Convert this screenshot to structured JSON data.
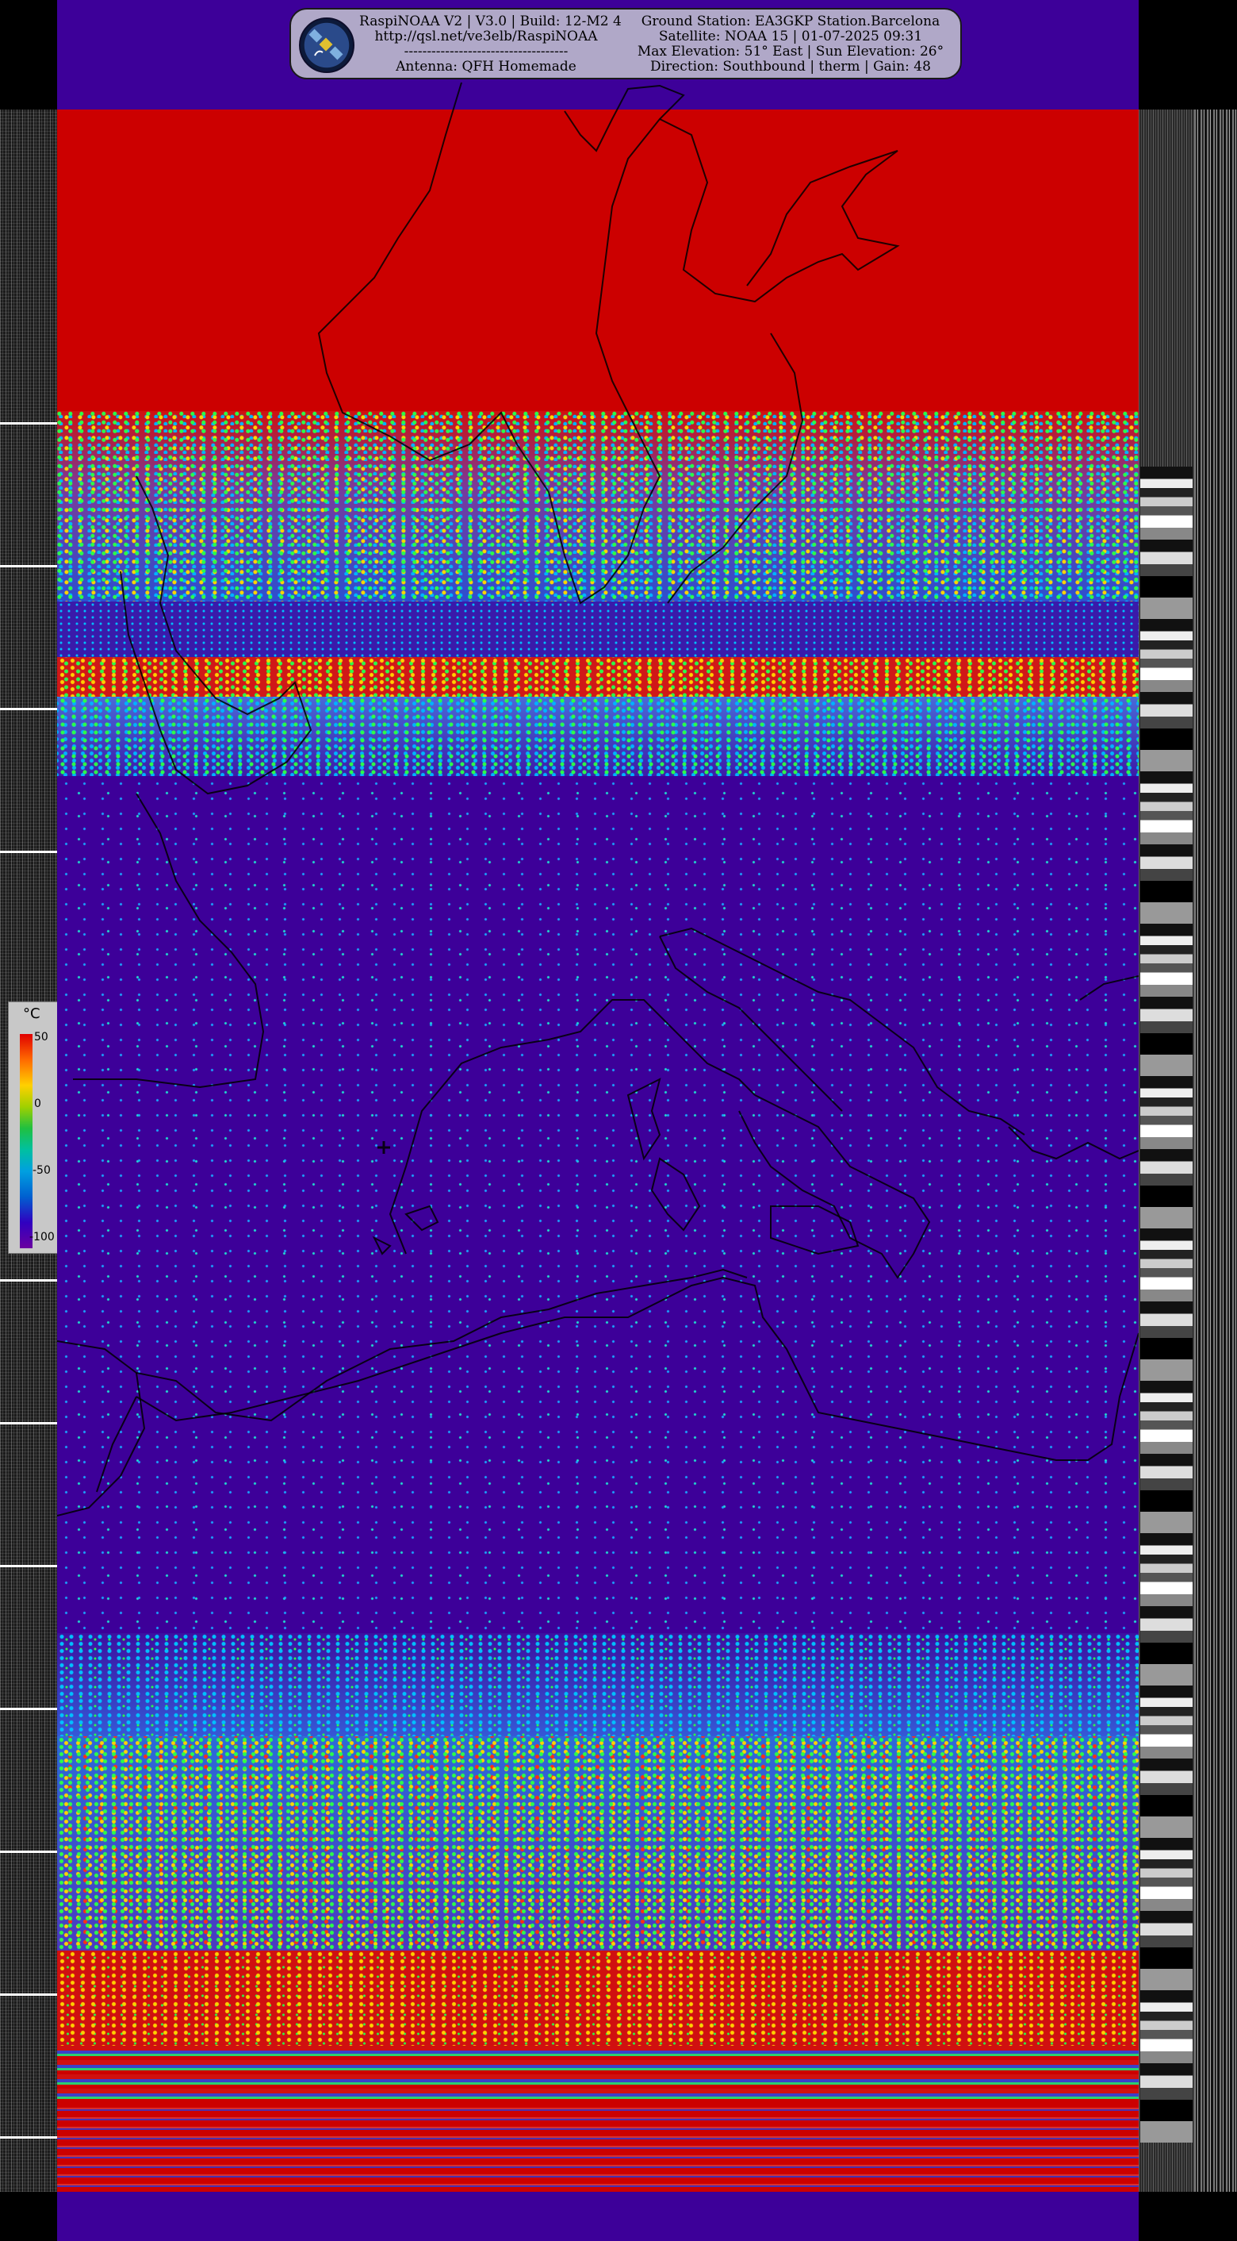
{
  "header": {
    "left_lines": [
      "RaspiNOAA V2 | V3.0 | Build: 12-M2 4",
      "http://qsl.net/ve3elb/RaspiNOAA",
      "------------------------------------",
      "Antenna: QFH Homemade"
    ],
    "right_lines": [
      "Ground Station: EA3GKP Station.Barcelona",
      "Satellite: NOAA 15 | 01-07-2025 09:31",
      "Max Elevation: 51° East | Sun Elevation: 26°",
      "Direction: Southbound | therm | Gain: 48"
    ],
    "logo_icon": "satellite-icon"
  },
  "temperature_scale": {
    "unit": "°C",
    "labels": [
      "50",
      "0",
      "-50",
      "-100"
    ]
  },
  "colors": {
    "cold_purple": "#3d0099",
    "hot_red": "#cc0000",
    "header_bg": "#b0a8c8"
  }
}
